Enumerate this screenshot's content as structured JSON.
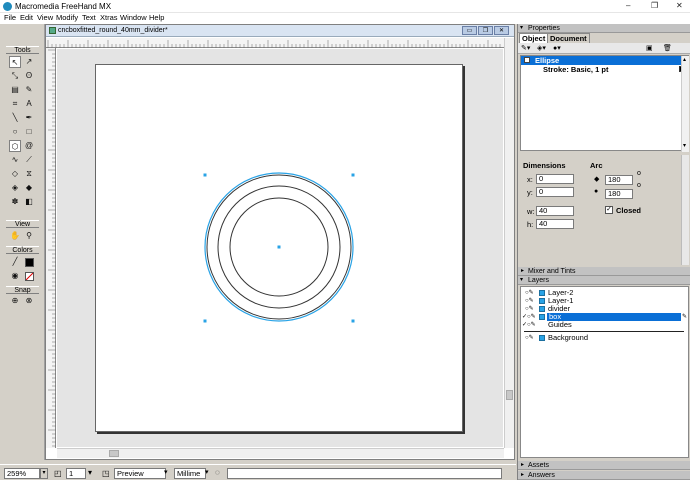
{
  "window": {
    "title": "Macromedia FreeHand MX",
    "controls": [
      "–",
      "❐",
      "✕"
    ]
  },
  "menu": [
    "File",
    "Edit",
    "View",
    "Modify",
    "Text",
    "Xtras",
    "Window",
    "Help"
  ],
  "toolbox": {
    "tools_label": "Tools",
    "view_label": "View",
    "colors_label": "Colors",
    "snap_label": "Snap"
  },
  "document": {
    "tab_name": "cncboxfitted_round_40mm_divider*",
    "colors": {
      "selection": "#29a3e6",
      "stroke": "#333333"
    }
  },
  "statusbar": {
    "zoom": "259%",
    "page": "1",
    "view_mode": "Preview",
    "units": "Millime"
  },
  "properties": {
    "panel_title": "Properties",
    "tabs": [
      "Object",
      "Document"
    ],
    "items": [
      {
        "label": "Ellipse",
        "selected": true
      },
      {
        "label": "Stroke: Basic, 1 pt",
        "selected": false
      }
    ],
    "dimensions": {
      "title": "Dimensions",
      "x_label": "x:",
      "x": "0",
      "y_label": "y:",
      "y": "0",
      "w_label": "w:",
      "w": "40",
      "h_label": "h:",
      "h": "40"
    },
    "arc": {
      "title": "Arc",
      "start": "180",
      "end": "180",
      "closed_label": "Closed",
      "closed": true
    }
  },
  "mixer": {
    "title": "Mixer and Tints"
  },
  "layers": {
    "title": "Layers",
    "items": [
      {
        "name": "Layer-2",
        "selected": false
      },
      {
        "name": "Layer-1",
        "selected": false
      },
      {
        "name": "divider",
        "selected": false
      },
      {
        "name": "box",
        "selected": true
      },
      {
        "name": "Guides",
        "selected": false
      }
    ],
    "background": "Background"
  },
  "assets": {
    "title": "Assets"
  },
  "answers": {
    "title": "Answers"
  }
}
